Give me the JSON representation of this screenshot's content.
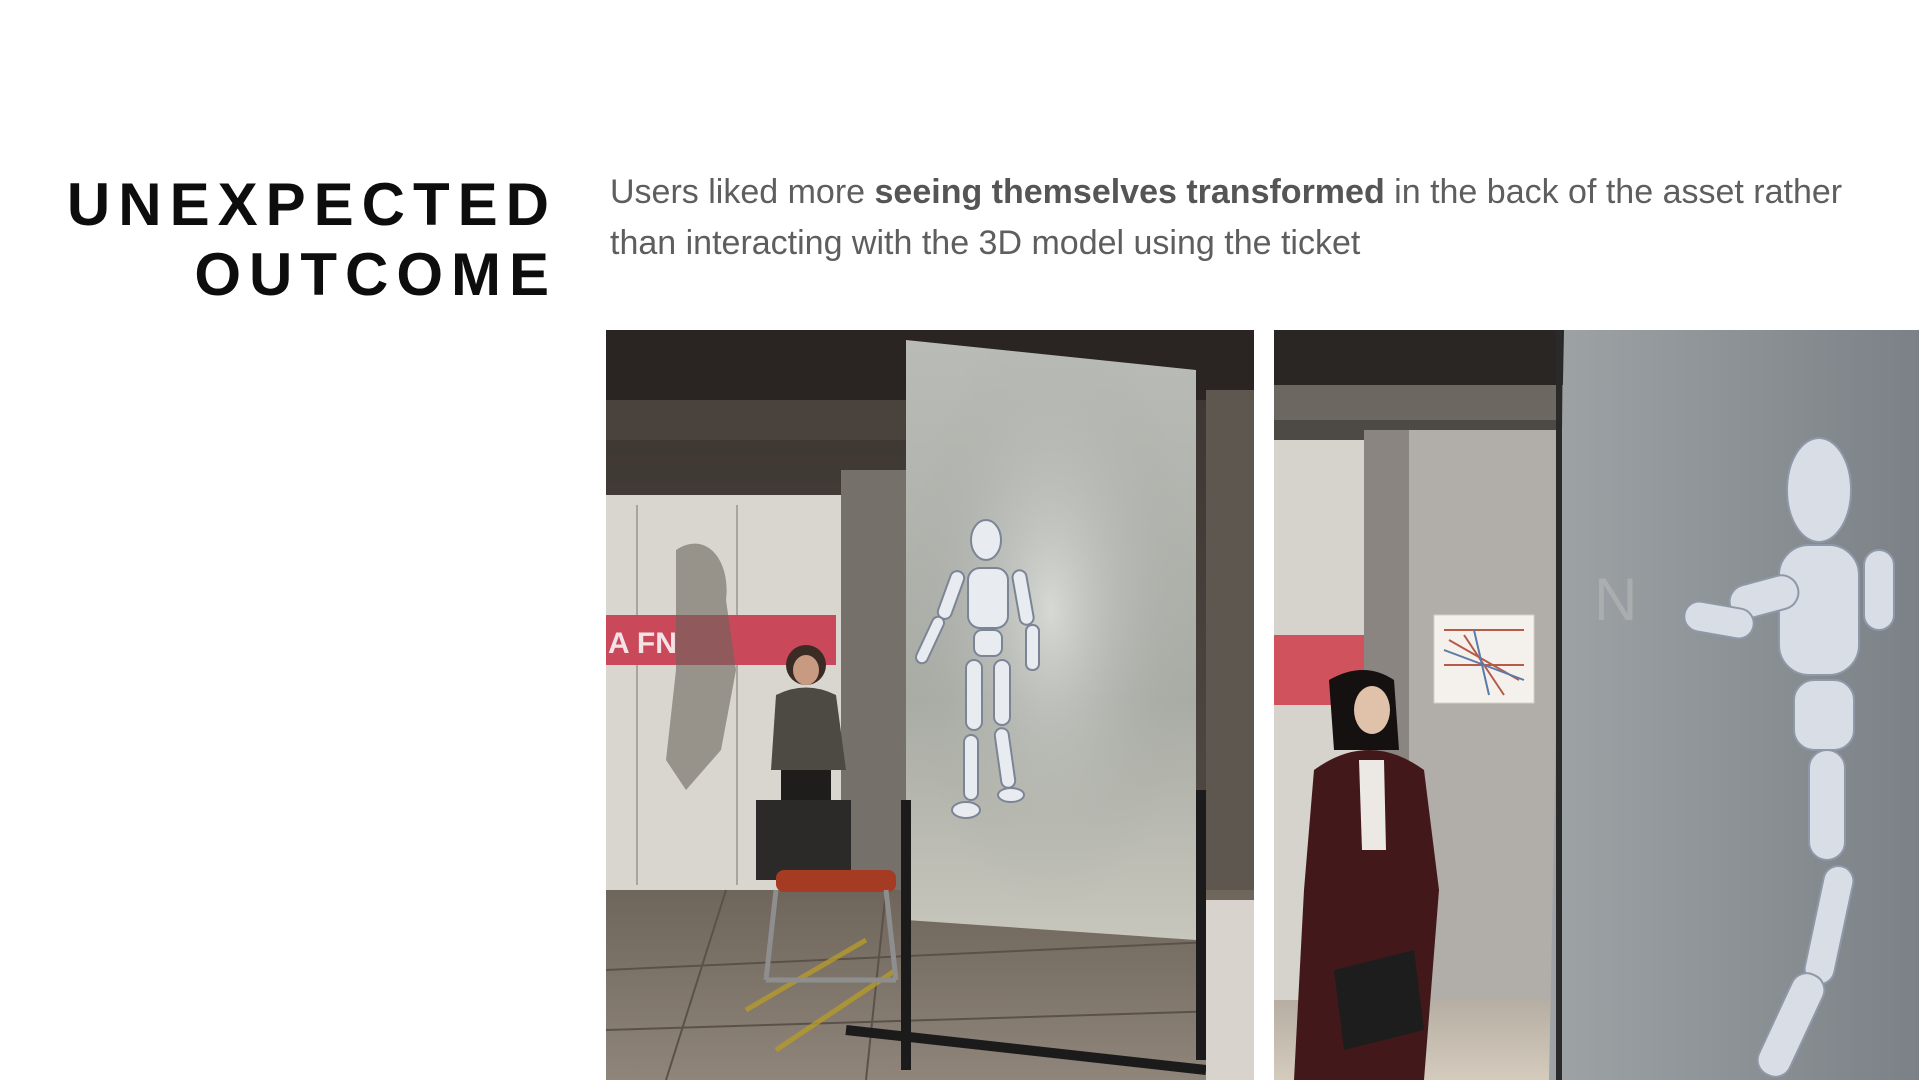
{
  "slide": {
    "title_line1": "UNEXPECTED",
    "title_line2": "OUTCOME",
    "description": {
      "before": "Users liked more ",
      "emphasis": "seeing themselves transformed",
      "after": " in the back of the asset rather than interacting with the 3D model using the ticket"
    }
  },
  "photos": [
    {
      "sign_text": "A FN"
    },
    {
      "sign_text": "N"
    }
  ]
}
